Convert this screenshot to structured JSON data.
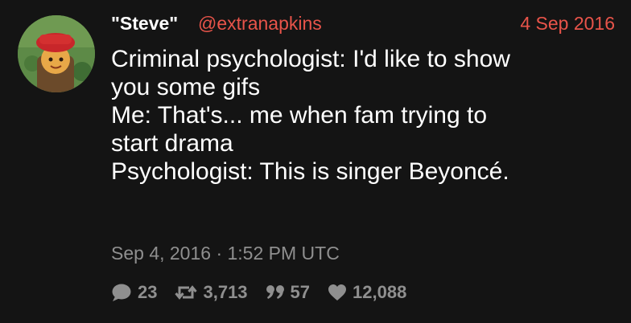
{
  "tweet": {
    "display_name": "\"Steve\"",
    "handle": "@extranapkins",
    "date": "4 Sep 2016",
    "lines": [
      "Criminal psychologist: I'd like to show",
      "you some gifs",
      "Me: That's... me when fam trying to",
      "start drama",
      "Psychologist: This is singer Beyoncé."
    ],
    "timestamp": "Sep 4, 2016 · 1:52 PM UTC",
    "stats": {
      "replies": "23",
      "retweets": "3,713",
      "quotes": "57",
      "likes": "12,088"
    }
  },
  "icons": {
    "reply": "comment-icon",
    "retweet": "retweet-icon",
    "quote": "quote-icon",
    "like": "heart-icon"
  },
  "colors": {
    "background": "#141414",
    "text": "#ffffff",
    "accent": "#e8544a",
    "muted": "#8f8f8f"
  }
}
